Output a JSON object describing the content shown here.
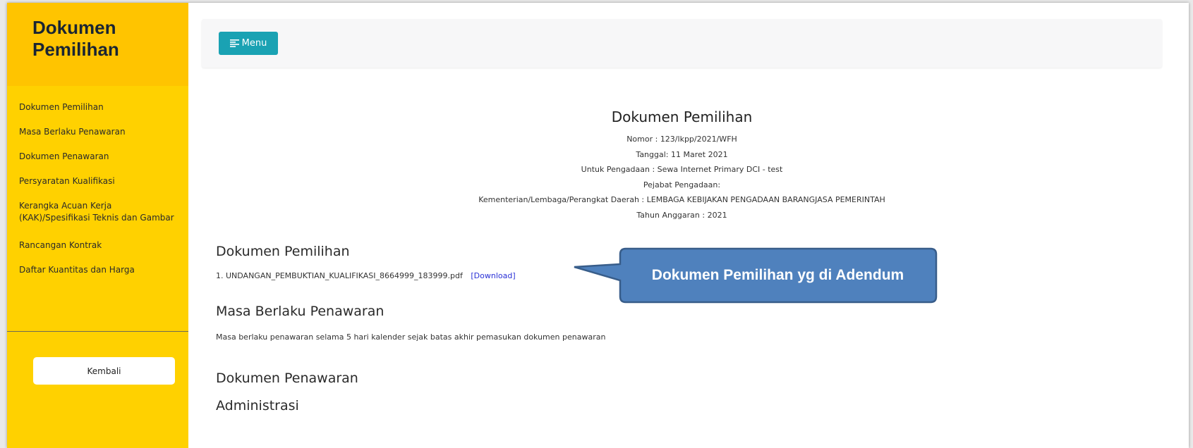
{
  "sidebar": {
    "title": "Dokumen Pemilihan",
    "items": [
      {
        "label": "Dokumen Pemilihan"
      },
      {
        "label": "Masa Berlaku Penawaran"
      },
      {
        "label": "Dokumen Penawaran"
      },
      {
        "label": "Persyaratan Kualifikasi"
      },
      {
        "label": "Kerangka Acuan Kerja (KAK)/Spesifikasi Teknis dan Gambar"
      },
      {
        "label": "Rancangan Kontrak"
      },
      {
        "label": "Daftar Kuantitas dan Harga"
      }
    ],
    "back_label": "Kembali"
  },
  "topbar": {
    "menu_label": "Menu",
    "menu_icon": "list-icon"
  },
  "document": {
    "title": "Dokumen Pemilihan",
    "nomor": "Nomor : 123/lkpp/2021/WFH",
    "tanggal": "Tanggal: 11 Maret 2021",
    "pengadaan": "Untuk Pengadaan : Sewa Internet Primary DCI - test",
    "pejabat": "Pejabat Pengadaan:",
    "instansi": "Kementerian/Lembaga/Perangkat Daerah : LEMBAGA KEBIJAKAN PENGADAAN BARANGJASA PEMERINTAH",
    "tahun": "Tahun Anggaran : 2021"
  },
  "sections": {
    "dokumen_pemilihan": {
      "heading": "Dokumen Pemilihan",
      "file": "1. UNDANGAN_PEMBUKTIAN_KUALIFIKASI_8664999_183999.pdf",
      "download_label": "[Download]"
    },
    "masa_berlaku": {
      "heading": "Masa Berlaku Penawaran",
      "text": "Masa berlaku penawaran selama 5 hari kalender sejak batas akhir pemasukan dokumen penawaran"
    },
    "dokumen_penawaran": {
      "heading": "Dokumen Penawaran",
      "subheading": "Administrasi"
    }
  },
  "callout": {
    "text": "Dokumen Pemilihan yg di Adendum"
  },
  "colors": {
    "sidebar_bg": "#ffd100",
    "sidebar_header_bg": "#ffc400",
    "menu_button": "#1aa2b3",
    "download_link": "#2930d6",
    "callout_fill": "#4f81bd",
    "callout_border": "#385d8a"
  }
}
